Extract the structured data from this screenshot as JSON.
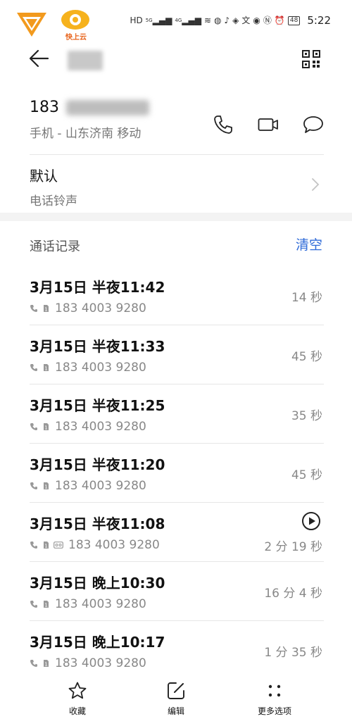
{
  "status_bar": {
    "cloud_app_label": "快上云",
    "network_labels": [
      "HD",
      "5G",
      "4G"
    ],
    "battery": "48",
    "time": "5:22"
  },
  "contact": {
    "phone_prefix": "183",
    "phone_location": "手机 - 山东济南 移动"
  },
  "ringtone": {
    "title": "默认",
    "subtitle": "电话铃声"
  },
  "call_log": {
    "title": "通话记录",
    "clear_label": "清空",
    "items": [
      {
        "time": "3月15日 半夜11:42",
        "number": "183 4003 9280",
        "duration": "14 秒",
        "voicemail": false
      },
      {
        "time": "3月15日 半夜11:33",
        "number": "183 4003 9280",
        "duration": "45 秒",
        "voicemail": false
      },
      {
        "time": "3月15日 半夜11:25",
        "number": "183 4003 9280",
        "duration": "35 秒",
        "voicemail": false
      },
      {
        "time": "3月15日 半夜11:20",
        "number": "183 4003 9280",
        "duration": "45 秒",
        "voicemail": false
      },
      {
        "time": "3月15日 半夜11:08",
        "number": "183 4003 9280",
        "duration": "2 分 19 秒",
        "voicemail": true
      },
      {
        "time": "3月15日 晚上10:30",
        "number": "183 4003 9280",
        "duration": "16 分 4 秒",
        "voicemail": false
      },
      {
        "time": "3月15日 晚上10:17",
        "number": "183 4003 9280",
        "duration": "1 分 35 秒",
        "voicemail": false
      }
    ]
  },
  "bottom_bar": {
    "favorite_label": "收藏",
    "edit_label": "编辑",
    "more_label": "更多选项"
  },
  "colors": {
    "accent": "#2f6bd8",
    "app_orange": "#f29a1e"
  }
}
